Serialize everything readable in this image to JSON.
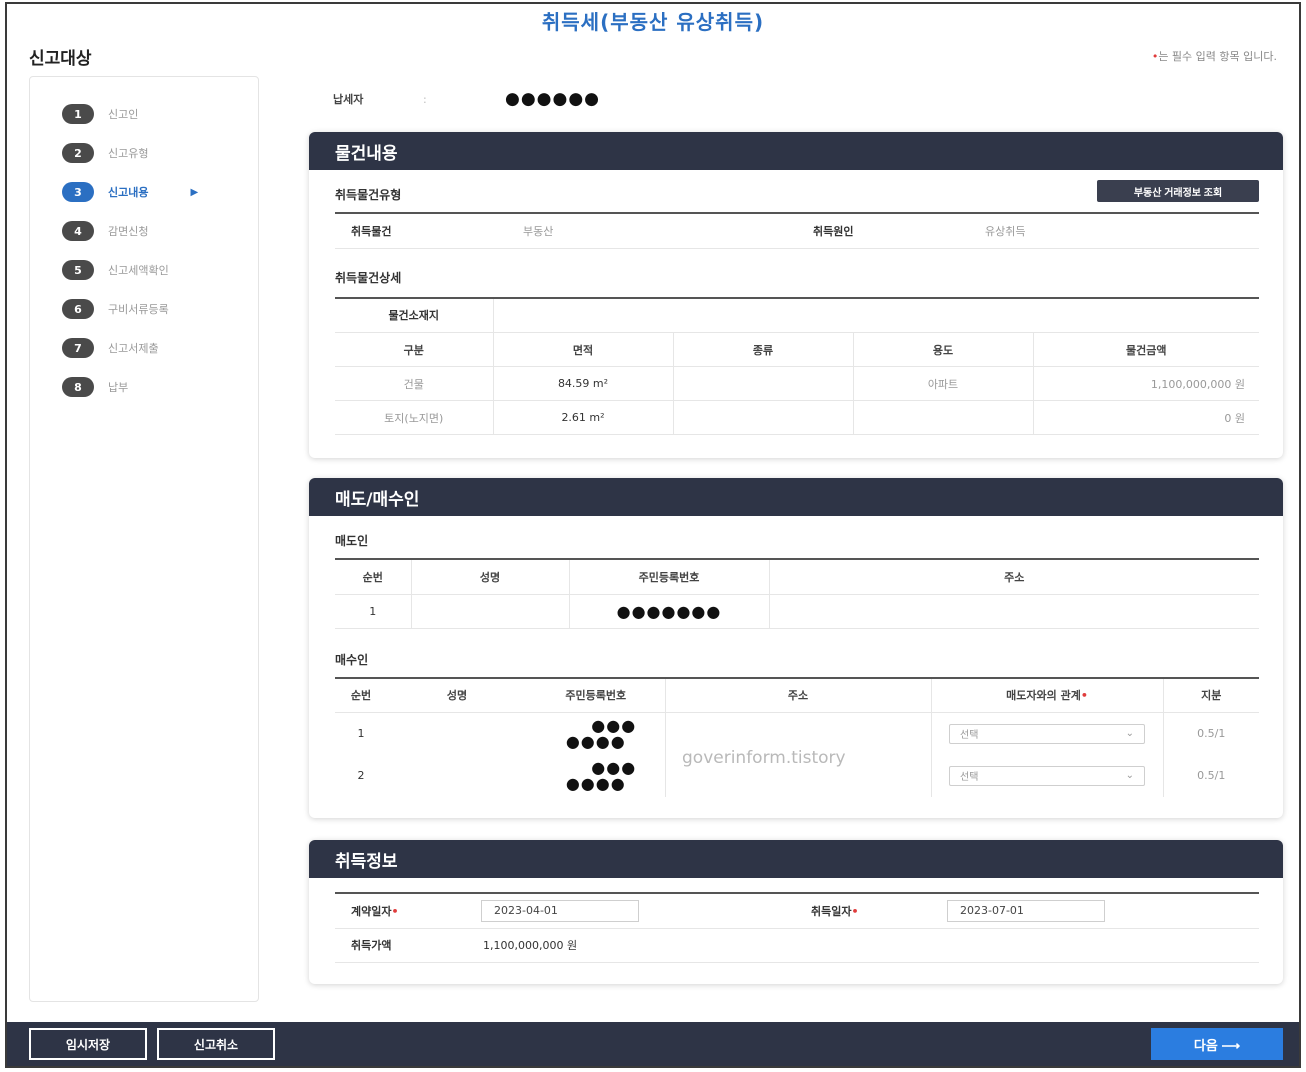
{
  "page_title": "취득세(부동산 유상취득)",
  "section_label": "신고대상",
  "required_note": "는 필수 입력 항목 입니다.",
  "required_star": "•",
  "sidebar": {
    "steps": [
      {
        "num": "1",
        "label": "신고인"
      },
      {
        "num": "2",
        "label": "신고유형"
      },
      {
        "num": "3",
        "label": "신고내용",
        "active": true
      },
      {
        "num": "4",
        "label": "감면신청"
      },
      {
        "num": "5",
        "label": "신고세액확인"
      },
      {
        "num": "6",
        "label": "구비서류등록"
      },
      {
        "num": "7",
        "label": "신고서제출"
      },
      {
        "num": "8",
        "label": "납부"
      }
    ],
    "active_arrow": "▶"
  },
  "payer": {
    "label": "납세자",
    "separator": ":",
    "value": "●●●●●●"
  },
  "property": {
    "header": "물건내용",
    "type_title": "취득물건유형",
    "lookup_button": "부동산 거래정보 조회",
    "type_row": {
      "k1": "취득물건",
      "v1": "부동산",
      "k2": "취득원인",
      "v2": "유상취득"
    },
    "detail_title": "취득물건상세",
    "location_label": "물건소재지",
    "columns": [
      "구분",
      "면적",
      "종류",
      "용도",
      "물건금액"
    ],
    "rows": [
      [
        "건물",
        "84.59 m²",
        "",
        "아파트",
        "1,100,000,000 원"
      ],
      [
        "토지(노지면)",
        "2.61 m²",
        "",
        "",
        "0 원"
      ]
    ]
  },
  "parties": {
    "header": "매도/매수인",
    "seller_title": "매도인",
    "seller_columns": [
      "순번",
      "성명",
      "주민등록번호",
      "주소"
    ],
    "seller_rows": [
      [
        "1",
        "",
        "●●●●●●●",
        ""
      ]
    ],
    "buyer_title": "매수인",
    "buyer_columns": [
      "순번",
      "성명",
      "주민등록번호",
      "주소",
      "매도자와의 관계",
      "지분"
    ],
    "buyer_rows": [
      {
        "no": "1",
        "name": "",
        "id_line1": "●●●",
        "id_line2": "●●●●",
        "addr": "",
        "relation": "선택",
        "share": "0.5/1"
      },
      {
        "no": "2",
        "name": "",
        "id_line1": "●●●",
        "id_line2": "●●●●",
        "addr": "",
        "relation": "선택",
        "share": "0.5/1"
      }
    ]
  },
  "acquisition": {
    "header": "취득정보",
    "contract_date_label": "계약일자",
    "contract_date": "2023-04-01",
    "acq_date_label": "취득일자",
    "acq_date": "2023-07-01",
    "price_label": "취득가액",
    "price": "1,100,000,000 원"
  },
  "watermark": "goverinform.tistory",
  "footer": {
    "temp_save": "임시저장",
    "cancel": "신고취소",
    "next": "다음 ⟶"
  },
  "colors": {
    "accent": "#2b6fc2",
    "panel_header": "#2e3446",
    "next_button": "#2b7de0",
    "required": "#e03c3c"
  }
}
